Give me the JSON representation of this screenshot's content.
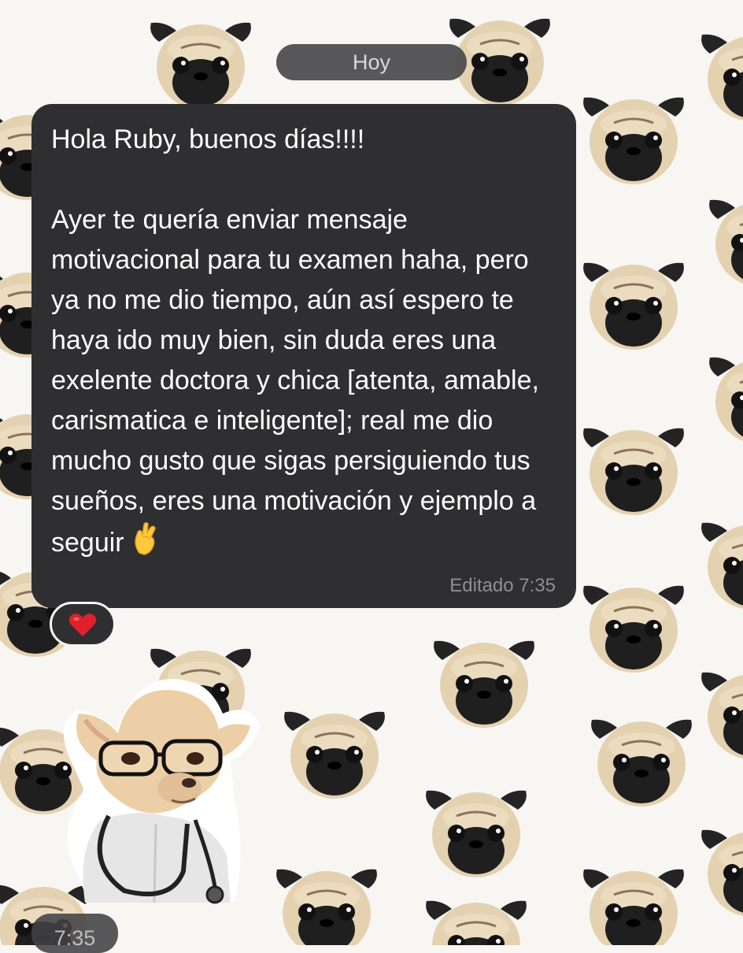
{
  "date_separator": "Hoy",
  "message": {
    "text": "Hola Ruby, buenos días!!!!\n\nAyer te quería enviar mensaje motivacional para tu examen haha, pero ya no me dio tiempo, aún así espero te haya ido muy bien, sin duda eres una exelente doctora y chica [atenta, amable, carismatica e inteligente]; real me dio mucho gusto que sigas persiguiendo tus sueños, eres una motivación y ejemplo a seguir",
    "emoji_icon": "crossed-fingers-icon",
    "meta": "Editado 7:35"
  },
  "reaction": {
    "icon": "red-heart-icon",
    "color": "#e0202a"
  },
  "sticker": {
    "icon": "chihuahua-doctor-sticker"
  },
  "sticker_time": "7:35",
  "colors": {
    "bubble": "#2f2f31",
    "pill": "#424246",
    "meta_text": "#8e8e93",
    "wallpaper": "#f7f6f3"
  }
}
